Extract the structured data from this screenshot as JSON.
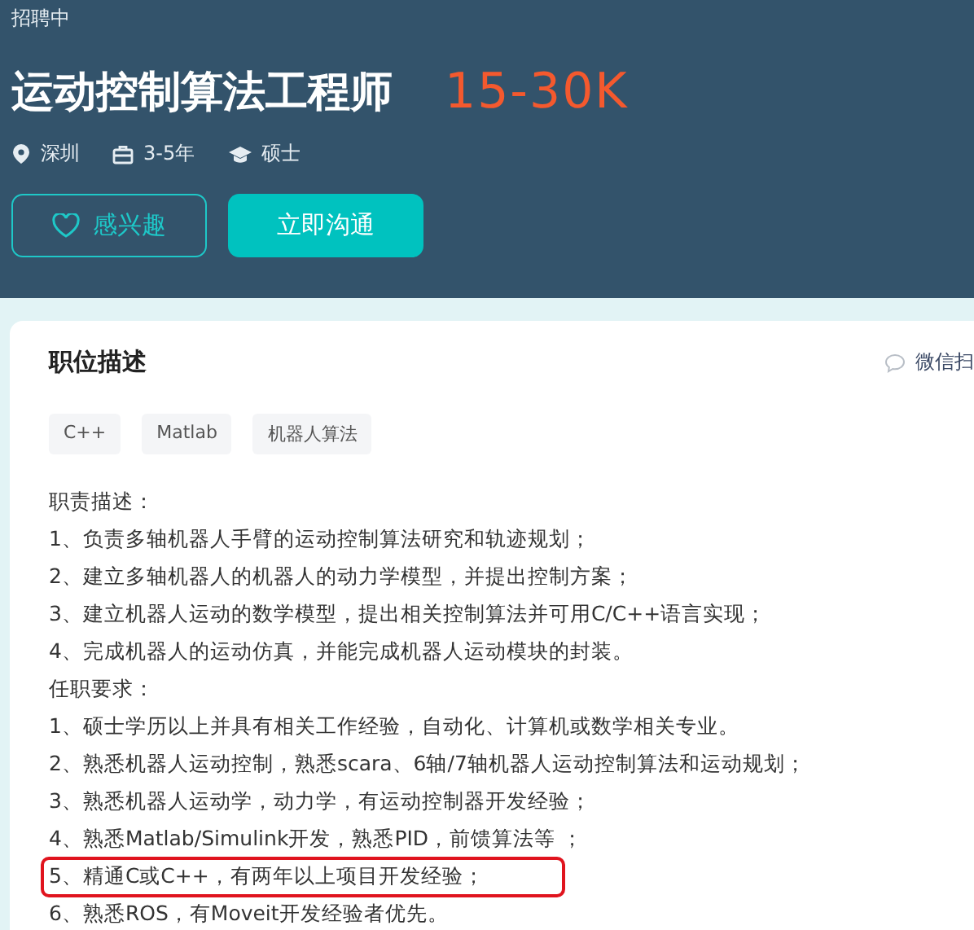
{
  "status": "招聘中",
  "job": {
    "title": "运动控制算法工程师",
    "salary": "15-30K"
  },
  "meta": [
    {
      "kind": "location",
      "text": "深圳"
    },
    {
      "kind": "experience",
      "text": "3-5年"
    },
    {
      "kind": "degree",
      "text": "硕士"
    }
  ],
  "buttons": [
    {
      "kind": "outline",
      "label": "感兴趣"
    },
    {
      "kind": "primary",
      "label": "立即沟通"
    }
  ],
  "card": {
    "title": "职位描述",
    "share": "微信扫",
    "tags": [
      "C++",
      "Matlab",
      "机器人算法"
    ],
    "lines": [
      {
        "text": "职责描述：",
        "highlighted": false
      },
      {
        "text": "1、负责多轴机器人手臂的运动控制算法研究和轨迹规划；",
        "highlighted": false
      },
      {
        "text": "2、建立多轴机器人的机器人的动力学模型，并提出控制方案；",
        "highlighted": false
      },
      {
        "text": "3、建立机器人运动的数学模型，提出相关控制算法并可用C/C++语言实现；",
        "highlighted": false
      },
      {
        "text": "4、完成机器人的运动仿真，并能完成机器人运动模块的封装。",
        "highlighted": false
      },
      {
        "text": "任职要求：",
        "highlighted": false
      },
      {
        "text": "1、硕士学历以上并具有相关工作经验，自动化、计算机或数学相关专业。",
        "highlighted": false
      },
      {
        "text": "2、熟悉机器人运动控制，熟悉scara、6轴/7轴机器人运动控制算法和运动规划；",
        "highlighted": false
      },
      {
        "text": "3、熟悉机器人运动学，动力学，有运动控制器开发经验；",
        "highlighted": false
      },
      {
        "text": "4、熟悉Matlab/Simulink开发，熟悉PID，前馈算法等 ；",
        "highlighted": false
      },
      {
        "text": "5、精通C或C++，有两年以上项目开发经验；",
        "highlighted": true
      },
      {
        "text": "6、熟悉ROS，有Moveit开发经验者优先。",
        "highlighted": false
      }
    ]
  }
}
